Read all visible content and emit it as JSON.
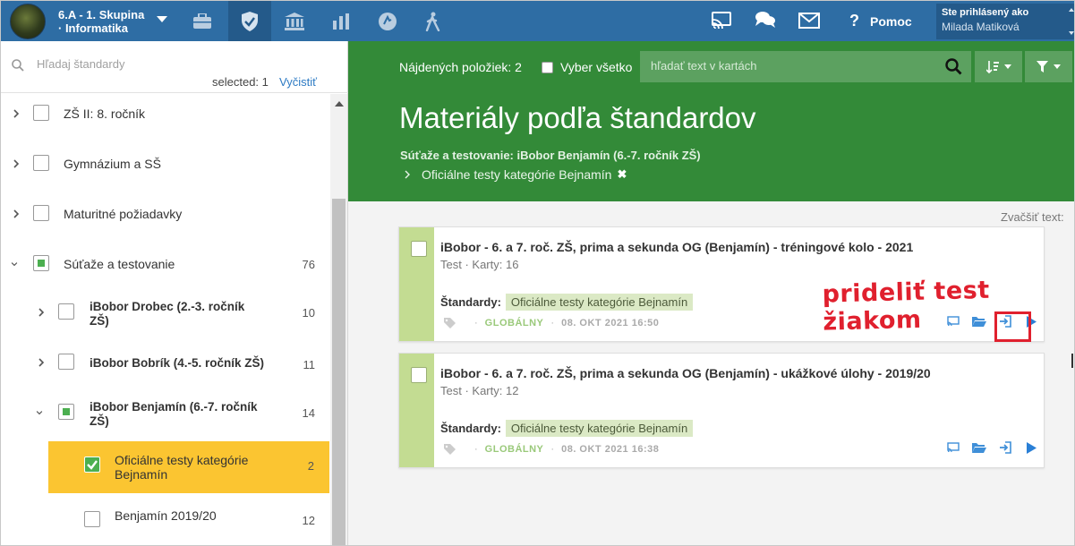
{
  "topbar": {
    "group_line1": "6.A - 1. Skupina",
    "group_line2": "· Informatika",
    "help_label": "Pomoc",
    "logged_as": "Ste prihlásený ako",
    "user_name": "Milada Matiková",
    "nav_icons": [
      "briefcase-icon",
      "shield-icon",
      "institution-icon",
      "bar-chart-icon",
      "award-icon",
      "hiking-icon"
    ],
    "right_icons": [
      "cast-icon",
      "chat-icon",
      "mail-icon"
    ]
  },
  "sidebar": {
    "search_placeholder": "Hľadaj štandardy",
    "selected_text": "selected: 1",
    "clear_label": "Vyčistiť",
    "items": [
      {
        "label": "ZŠ II: 8. ročník",
        "count": ""
      },
      {
        "label": "Gymnázium a SŠ",
        "count": ""
      },
      {
        "label": "Maturitné požiadavky",
        "count": ""
      },
      {
        "label": "Súťaže a testovanie",
        "count": "76"
      },
      {
        "label": "iBobor Drobec (2.-3. ročník ZŠ)",
        "count": "10"
      },
      {
        "label": "iBobor Bobrík (4.-5. ročník ZŠ)",
        "count": "11"
      },
      {
        "label": "iBobor Benjamín (6.-7. ročník ZŠ)",
        "count": "14"
      },
      {
        "label": "Oficiálne testy kategórie Bejnamín",
        "count": "2"
      },
      {
        "label": "Benjamín 2019/20",
        "count": "12"
      }
    ]
  },
  "header": {
    "found_text": "Nájdených položiek: 2",
    "select_all_label": "Vyber všetko",
    "card_search_placeholder": "hľadať text v kartách",
    "page_title": "Materiály podľa štandardov",
    "crumb_main": "Súťaže a testovanie: iBobor Benjamín (6.-7. ročník ZŠ)",
    "crumb_sub": "Oficiálne testy kategórie Bejnamín"
  },
  "zoom_text": "Zvačšiť text:",
  "cards": [
    {
      "title": "iBobor - 6. a 7. roč. ZŠ, prima a sekunda OG (Benjamín) - tréningové kolo - 2021",
      "meta": "Test · Karty: 16",
      "std_label": "Štandardy:",
      "std_chip": "Oficiálne testy kategórie Bejnamín",
      "scope": "GLOBÁLNY",
      "date": "08. OKT 2021 16:50"
    },
    {
      "title": "iBobor - 6. a 7. roč. ZŠ, prima a sekunda OG (Benjamín) - ukážkové úlohy - 2019/20",
      "meta": "Test · Karty: 12",
      "std_label": "Štandardy:",
      "std_chip": "Oficiálne testy kategórie Bejnamín",
      "scope": "GLOBÁLNY",
      "date": "08. OKT 2021 16:38"
    }
  ],
  "annotation": "prideliť test žiakom",
  "colors": {
    "topbar": "#2e6da4",
    "header_green": "#338a38",
    "selected_item": "#fbc531",
    "card_stripe": "#c3dc92",
    "annotation_red": "#e0202e"
  }
}
